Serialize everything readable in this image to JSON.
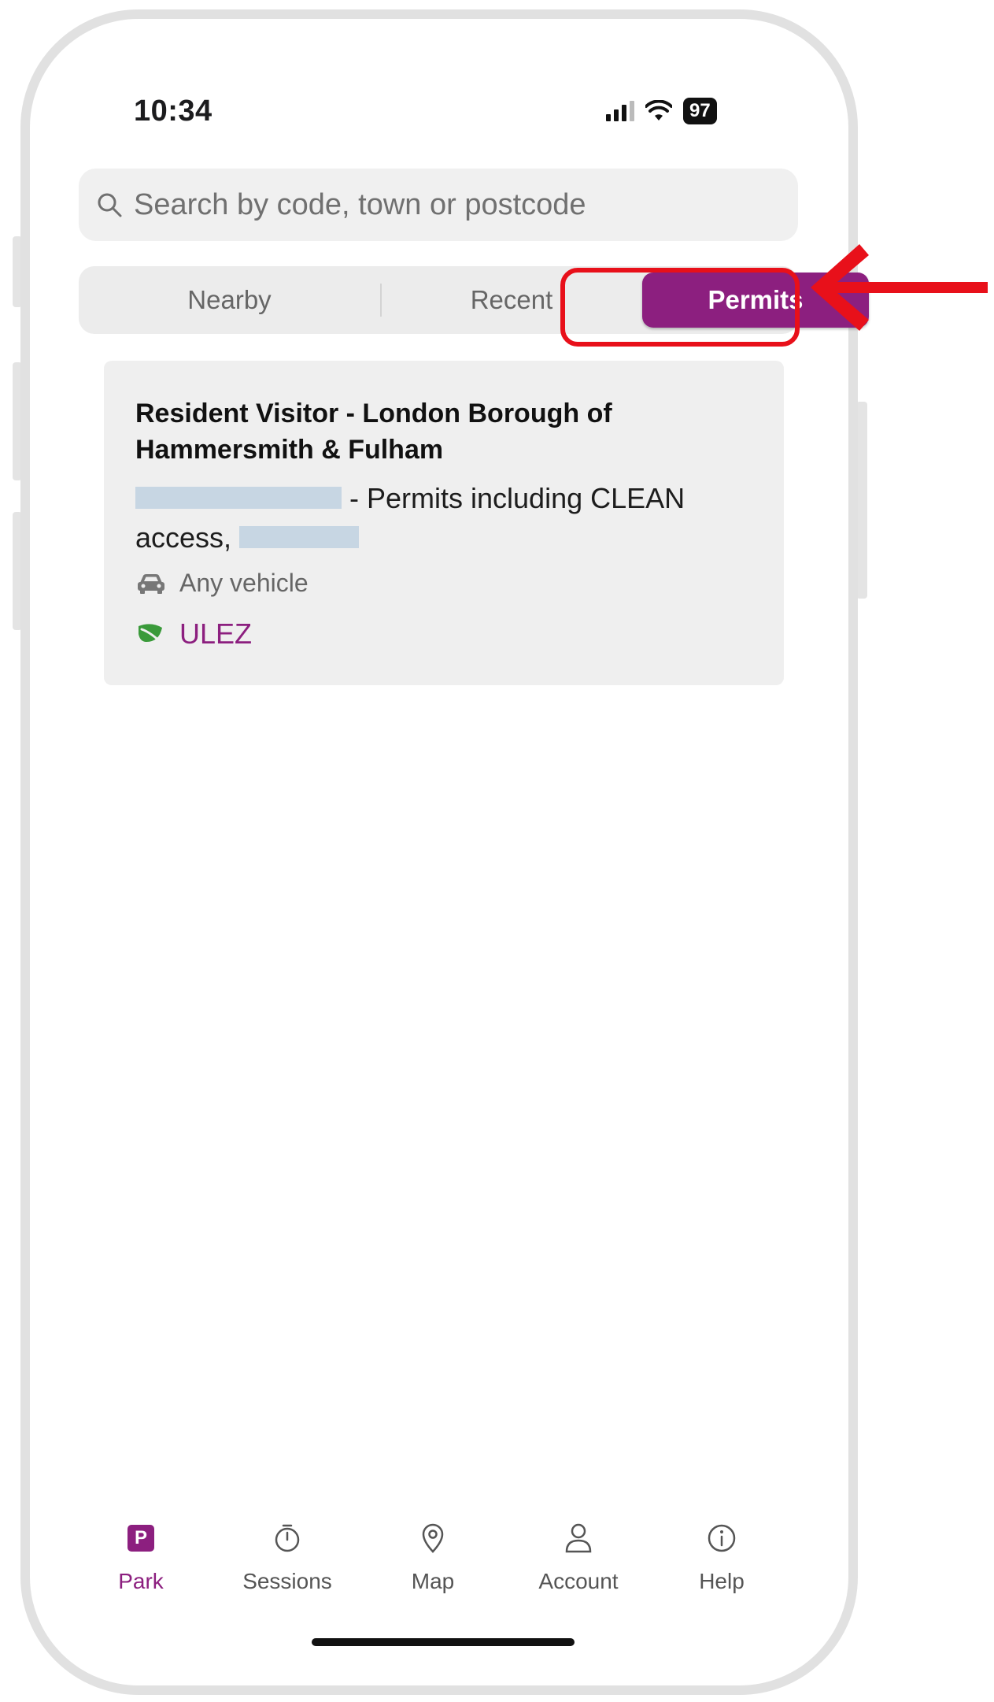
{
  "status_bar": {
    "time": "10:34",
    "battery": "97"
  },
  "search": {
    "placeholder": "Search by code, town or postcode",
    "icon": "search-icon"
  },
  "segments": {
    "items": [
      {
        "label": "Nearby"
      },
      {
        "label": "Recent"
      },
      {
        "label": "Permits"
      }
    ],
    "selected": "Permits"
  },
  "permit_card": {
    "title": "Resident Visitor - London Borough of Hammersmith & Fulham",
    "description_visible": "- Permits including CLEAN",
    "description_line2": "access,",
    "vehicle": "Any vehicle",
    "zone": "ULEZ",
    "vehicle_icon": "car-icon",
    "zone_icon": "leaf-icon"
  },
  "tabbar": {
    "items": [
      {
        "label": "Park",
        "icon": "park-icon",
        "icon_text": "P"
      },
      {
        "label": "Sessions",
        "icon": "stopwatch-icon"
      },
      {
        "label": "Map",
        "icon": "map-pin-icon"
      },
      {
        "label": "Account",
        "icon": "user-icon"
      },
      {
        "label": "Help",
        "icon": "info-icon"
      }
    ],
    "active": "Park"
  },
  "colors": {
    "accent": "#8c1f7f",
    "highlight": "#e8101a",
    "zone_leaf": "#3a9a3a"
  }
}
